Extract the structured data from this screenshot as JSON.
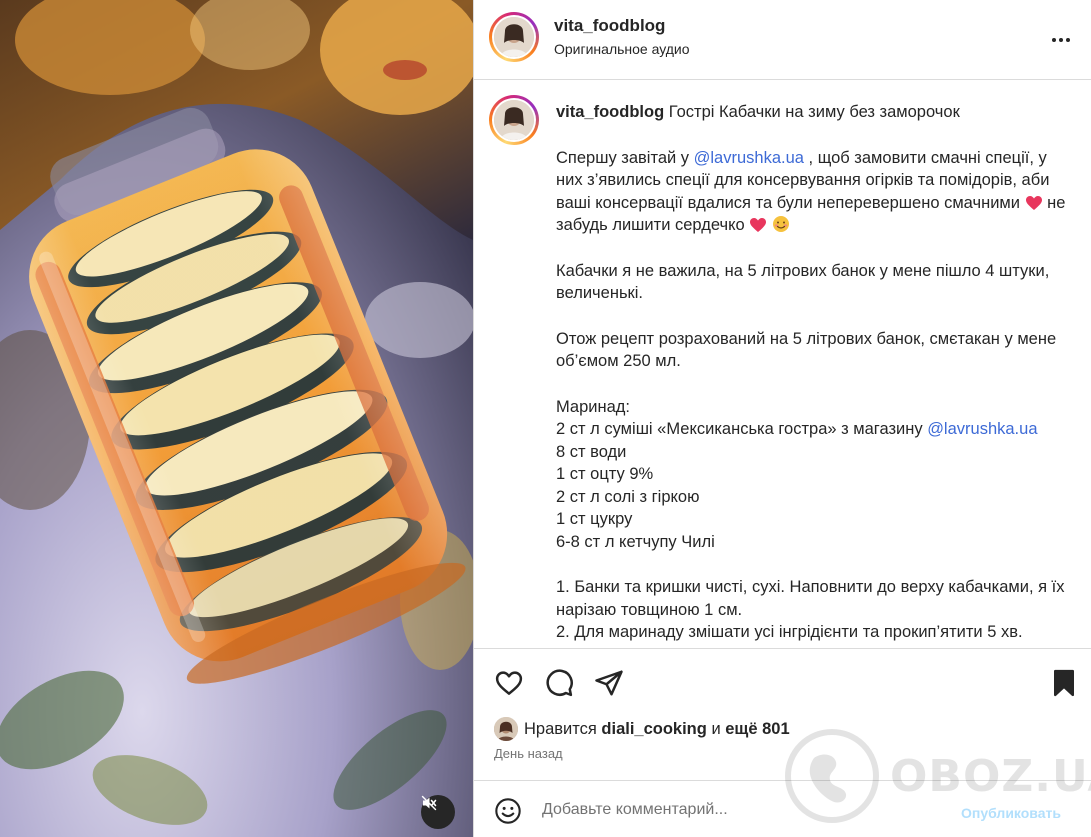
{
  "post": {
    "username": "vita_foodblog",
    "audio_label": "Оригинальное аудио"
  },
  "caption": {
    "username": "vita_foodblog",
    "title": "Гострі Кабачки на зиму без заморочок",
    "p1_before": "Спершу завітай у ",
    "p1_mention": "@lavrushka.ua",
    "p1_after": " , щоб замовити смачні спеції, у них з’явились спеції для консервування огірків та помідорів, аби ваші консервації вдалися та були неперевершено смачними ",
    "p1_mid": " не забудь лишити сердечко ",
    "p2": "Кабачки я не важила, на 5 літрових банок у мене пішло 4 штуки, величенькі.",
    "p3": "Отож рецепт розрахований на 5 літрових банок, смєтакан у мене об’ємом 250 мл.",
    "marinade_heading": "Маринад:",
    "marinade_line1_before": "2 ст л суміші «Мексиканська гостра» з магазину ",
    "marinade_line1_mention": "@lavrushka.ua",
    "marinade_lines": [
      "8 ст води",
      "1 ст оцту 9%",
      "2 ст л солі з гіркою",
      "1 ст цукру",
      "6-8 ст л кетчупу Чилі"
    ],
    "steps": [
      "1. Банки та кришки чисті, сухі. Наповнити до верху кабачками, я їх нарізаю товщиною 1 см.",
      "2. Для маринаду змішати усі інгрідієнти та прокип’ятити 5 хв."
    ]
  },
  "likes": {
    "prefix": "Нравится",
    "user": "diali_cooking",
    "joiner": "и",
    "others": "ещё 801"
  },
  "date_label": "День назад",
  "comment": {
    "placeholder": "Добавьте комментарий...",
    "post_label": "Опубликовать"
  },
  "watermark": {
    "text": "OBOZ.UA"
  },
  "icons": {
    "more": "more-horizontal-icon",
    "like": "heart-outline-icon",
    "comment": "comment-bubble-icon",
    "share": "paper-plane-icon",
    "save": "bookmark-filled-icon",
    "emoji": "smiley-icon",
    "mute": "speaker-muted-icon"
  },
  "colors": {
    "mention": "#3d6ad6",
    "post_button": "#b2dffc",
    "heart_emoji": "#e8365d",
    "text": "#262626",
    "secondary": "#737373",
    "divider": "#dbdbdb"
  }
}
